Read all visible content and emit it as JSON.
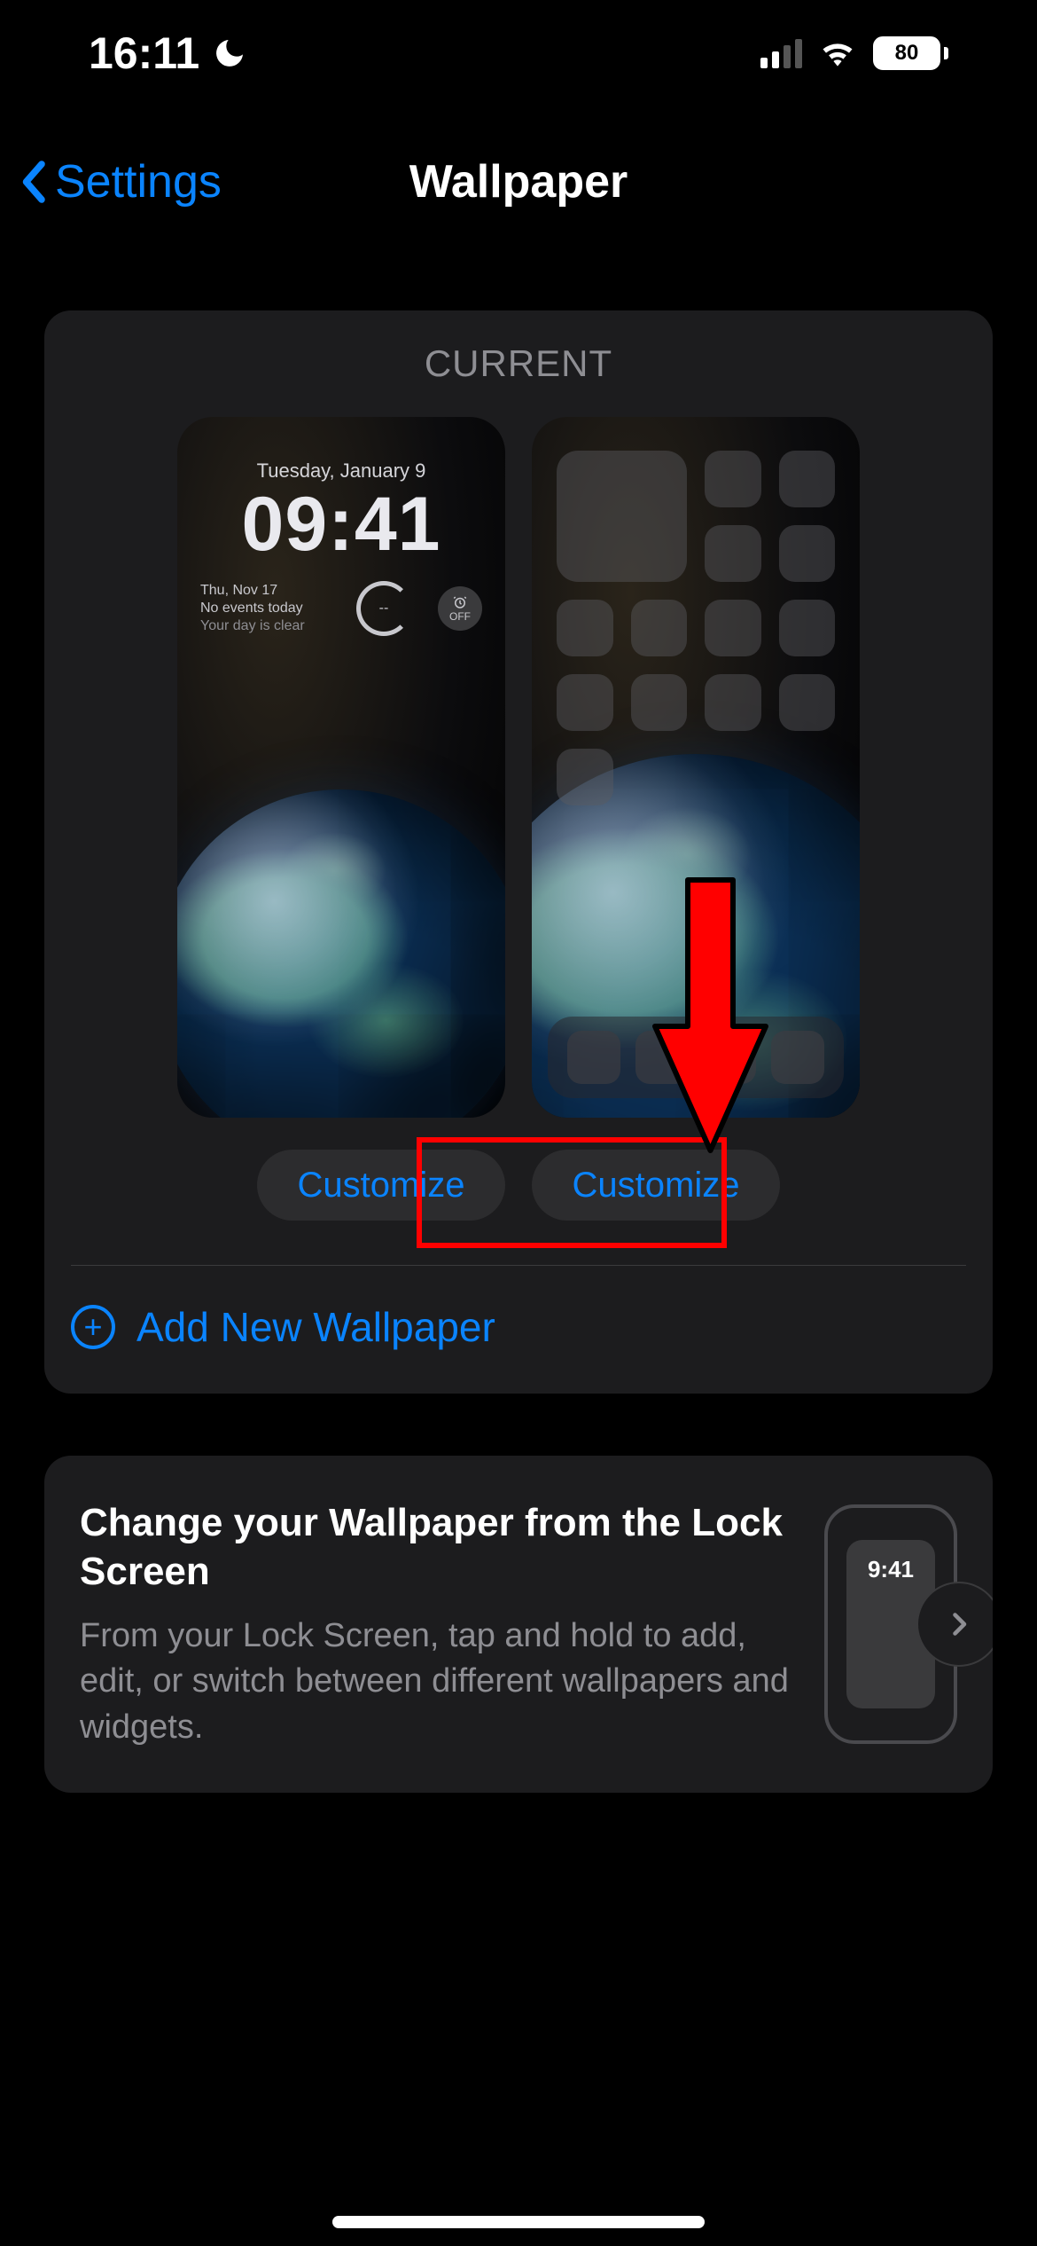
{
  "status": {
    "time": "16:11",
    "battery_percent": "80"
  },
  "nav": {
    "back_label": "Settings",
    "title": "Wallpaper"
  },
  "current": {
    "header": "CURRENT",
    "lock_preview": {
      "date": "Tuesday, January 9",
      "time": "09:41",
      "widget_line1": "Thu, Nov 17",
      "widget_line2": "No events today",
      "widget_line3": "Your day is clear",
      "alarm_label": "OFF"
    },
    "customize_lock_label": "Customize",
    "customize_home_label": "Customize",
    "add_new_label": "Add New Wallpaper"
  },
  "tip": {
    "title": "Change your Wallpaper from the Lock Screen",
    "description": "From your Lock Screen, tap and hold to add, edit, or switch between different wallpapers and widgets.",
    "thumb_time": "9:41"
  }
}
